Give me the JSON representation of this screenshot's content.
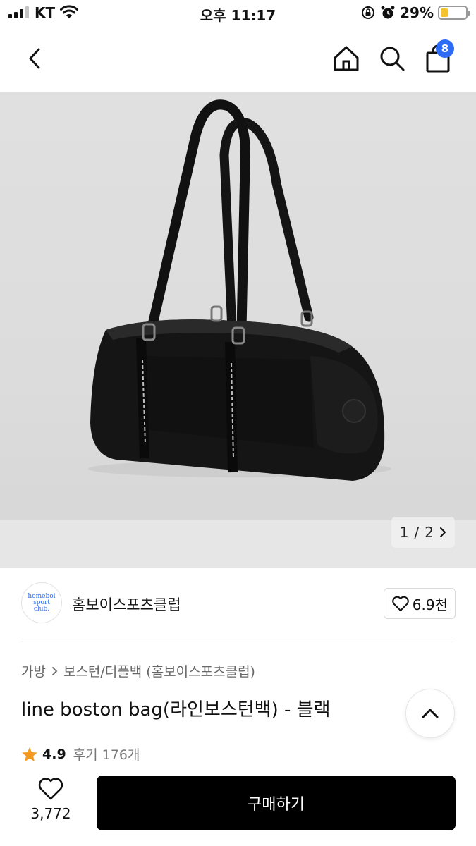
{
  "status_bar": {
    "carrier": "KT",
    "time": "오후 11:17",
    "battery_percent": "29%",
    "battery_level": 0.29,
    "icons": [
      "signal-icon",
      "wifi-icon",
      "orientation-lock-icon",
      "alarm-icon",
      "battery-icon"
    ]
  },
  "nav": {
    "icons": [
      "back-icon",
      "home-icon",
      "search-icon",
      "shopping-bag-icon"
    ],
    "cart_badge": "8"
  },
  "gallery": {
    "current": "1",
    "separator": "/",
    "total": "2",
    "next_icon": "chevron-right-icon"
  },
  "brand": {
    "logo_line1": "homeboi",
    "logo_line2": "sport",
    "logo_line3": "club.",
    "name": "홈보이스포츠클럽",
    "likes": "6.9천"
  },
  "product": {
    "breadcrumb_category": "가방",
    "breadcrumb_subcategory": "보스턴/더플백 (홈보이스포츠클럽)",
    "title": "line boston bag(라인보스턴백) - 블랙",
    "rating": "4.9",
    "review_label": "후기 176개"
  },
  "bottom_bar": {
    "wish_count": "3,772",
    "buy_label": "구매하기"
  },
  "colors": {
    "accent_blue": "#2f6cf5",
    "star": "#f29a1f",
    "buy_button": "#000000",
    "battery": "#f4c430"
  }
}
